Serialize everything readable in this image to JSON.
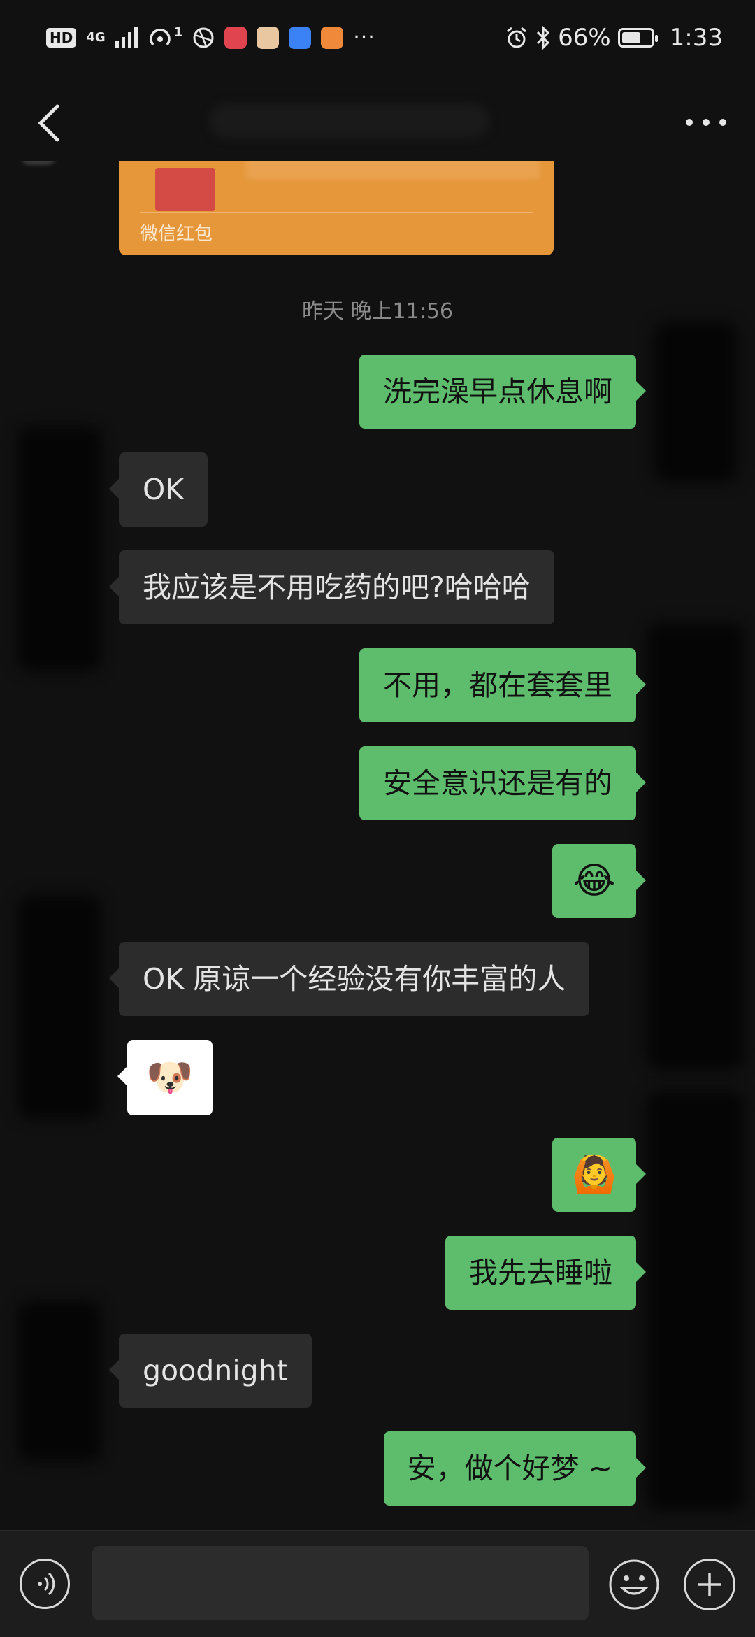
{
  "status_bar": {
    "hd": "HD",
    "network": "4G",
    "hotspot_badge": "1",
    "more": "···",
    "battery": "66%",
    "battery_level_percent": 66,
    "time": "1:33"
  },
  "nav": {
    "back_icon": "chevron-left-icon",
    "more_icon": "more-dots-icon"
  },
  "red_packet": {
    "label": "微信红包",
    "color": "#E5973A"
  },
  "timestamp": "昨天 晚上11:56",
  "messages": [
    {
      "side": "out",
      "text": "洗完澡早点休息啊"
    },
    {
      "side": "in",
      "text": "OK"
    },
    {
      "side": "in",
      "text": "我应该是不用吃药的吧?哈哈哈"
    },
    {
      "side": "out",
      "text": "不用，都在套套里"
    },
    {
      "side": "out",
      "text": "安全意识还是有的"
    },
    {
      "side": "out",
      "text": "😂"
    },
    {
      "side": "in",
      "text": "OK 原谅一个经验没有你丰富的人"
    },
    {
      "side": "in",
      "text": "🐶"
    },
    {
      "side": "out",
      "text": "🙆"
    },
    {
      "side": "out",
      "text": "我先去睡啦"
    },
    {
      "side": "in",
      "text": "goodnight"
    },
    {
      "side": "out",
      "text": "安，做个好梦 ~"
    }
  ],
  "colors": {
    "outgoing_bubble": "#5EBD6D",
    "incoming_bubble": "#2C2C2C",
    "background": "#111111"
  },
  "input_bar": {
    "voice_icon": "voice-icon",
    "emoji_icon": "emoji-icon",
    "plus_icon": "plus-icon"
  }
}
